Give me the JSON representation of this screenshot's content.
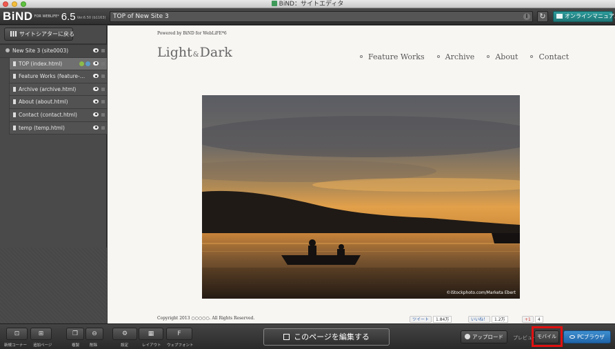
{
  "window": {
    "title": "BiND：サイトエディタ"
  },
  "toolbar": {
    "logo_text": "BiND",
    "logo_for": "FOR WEBLIFE*",
    "version": "6.5",
    "build": "Ver.6.50 (b1163)",
    "page_title": "TOP of New Site 3",
    "manual_label": "オンラインマニュアル"
  },
  "sidebar": {
    "back_label": "サイトシアターに戻る",
    "site": {
      "label": "New Site 3 (site0003)"
    },
    "pages": [
      {
        "label": "TOP (index.html)"
      },
      {
        "label": "Feature Works (feature-work..."
      },
      {
        "label": "Archive (archive.html)"
      },
      {
        "label": "About (about.html)"
      },
      {
        "label": "Contact (contact.html)"
      },
      {
        "label": "temp (temp.html)"
      }
    ]
  },
  "content": {
    "powered": "Powered by BiND for WebLiFE*6",
    "logo_main": "Light",
    "logo_amp": "&",
    "logo_end": "Dark",
    "nav": [
      "Feature Works",
      "Archive",
      "About",
      "Contact"
    ],
    "photo_credit": "©iStockphoto.com/Marketa Ebert",
    "copyright": "Copyright 2013 ○○○○○. All Rights Reserved.",
    "social": {
      "tweet_label": "ツイート",
      "tweet_count": "1.84万",
      "like_label": "いいね！",
      "like_count": "1.2万",
      "plus_label": "+1",
      "plus_count": "4"
    }
  },
  "bottombar": {
    "new_corner": "新規コーナー",
    "add_page": "追加ページ",
    "duplicate": "複製",
    "delete": "削除",
    "settings": "設定",
    "layout": "レイアウト",
    "webfont": "ウェブフォント",
    "edit_page": "このページを編集する",
    "upload": "アップロード",
    "preview": "プレビュー",
    "mobile": "モバイル",
    "pc_browser": "PCブラウザ"
  }
}
